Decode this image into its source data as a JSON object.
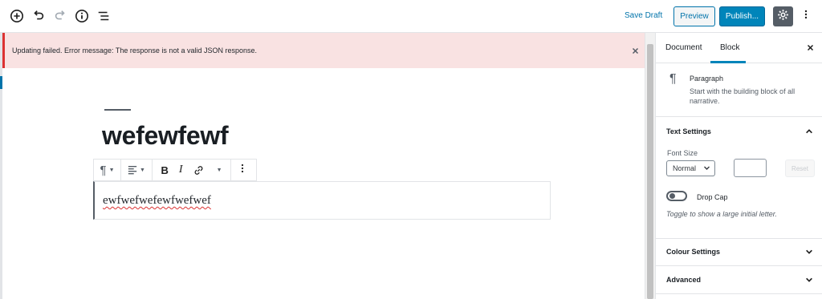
{
  "toolbar": {
    "icons": [
      "add-block-icon",
      "undo-icon",
      "redo-icon",
      "info-icon",
      "outline-icon"
    ],
    "save_draft": "Save Draft",
    "preview": "Preview",
    "publish": "Publish...",
    "colors": {
      "accent": "#0085ba",
      "link": "#0073aa",
      "settings_bg": "#555d66"
    }
  },
  "notice": {
    "message": "Updating failed. Error message: The response is not a valid JSON response.",
    "color": "#dc3232"
  },
  "editor": {
    "post_title": "wefewfewf",
    "paragraph_text": "ewfwefwefewfwefwef",
    "block_toolbar": {
      "paragraph_icon": "¶"
    }
  },
  "sidebar": {
    "tabs": [
      {
        "label": "Document"
      },
      {
        "label": "Block"
      }
    ],
    "active_tab": "Block",
    "block_card": {
      "icon": "¶",
      "title": "Paragraph",
      "description": "Start with the building block of all narrative."
    },
    "text_settings": {
      "title": "Text Settings",
      "font_size_label": "Font Size",
      "font_size_value": "Normal",
      "custom_size_value": "",
      "reset_label": "Reset",
      "drop_cap_label": "Drop Cap",
      "drop_cap_help": "Toggle to show a large initial letter."
    },
    "colour_settings": {
      "title": "Colour Settings"
    },
    "advanced": {
      "title": "Advanced"
    }
  }
}
